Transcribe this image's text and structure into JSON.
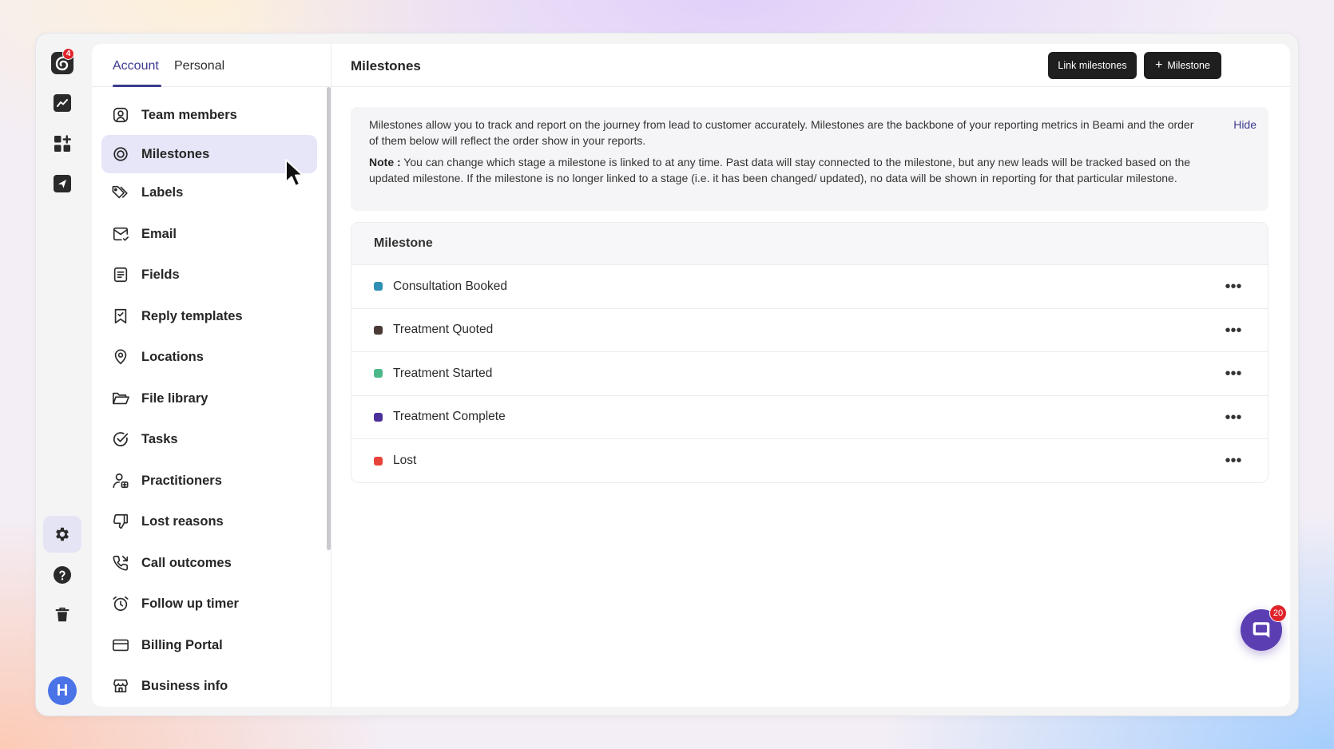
{
  "rail": {
    "logo_badge": "4",
    "avatar_initial": "H"
  },
  "settings_nav": {
    "tabs": [
      {
        "label": "Account",
        "active": true
      },
      {
        "label": "Personal",
        "active": false
      }
    ],
    "items": [
      {
        "label": "Team members",
        "icon": "user-square-icon"
      },
      {
        "label": "Milestones",
        "icon": "target-icon",
        "active": true
      },
      {
        "label": "Labels",
        "icon": "tags-icon"
      },
      {
        "label": "Email",
        "icon": "mail-check-icon"
      },
      {
        "label": "Fields",
        "icon": "form-fields-icon"
      },
      {
        "label": "Reply templates",
        "icon": "bookmark-check-icon"
      },
      {
        "label": "Locations",
        "icon": "map-pin-icon"
      },
      {
        "label": "File library",
        "icon": "folder-open-icon"
      },
      {
        "label": "Tasks",
        "icon": "check-circle-icon"
      },
      {
        "label": "Practitioners",
        "icon": "practitioner-icon"
      },
      {
        "label": "Lost reasons",
        "icon": "thumbs-down-icon"
      },
      {
        "label": "Call outcomes",
        "icon": "phone-outgoing-icon"
      },
      {
        "label": "Follow up timer",
        "icon": "alarm-clock-icon"
      },
      {
        "label": "Billing Portal",
        "icon": "credit-card-icon"
      },
      {
        "label": "Business info",
        "icon": "store-icon"
      }
    ]
  },
  "header": {
    "title": "Milestones",
    "link_button": "Link milestones",
    "add_button": "Milestone"
  },
  "info": {
    "text": "Milestones allow you to track and report on the journey from lead to customer accurately. Milestones are the backbone of your reporting metrics in Beami and the order of them below will reflect the order show in your reports.",
    "note_label": "Note :",
    "note_text": " You can change which stage a milestone is linked to at any time. Past data will stay connected to the milestone, but any new leads will be tracked based on the updated milestone. If the milestone is no longer linked to a stage (i.e. it has been changed/ updated), no data will be shown in reporting for that particular milestone.",
    "hide_label": "Hide"
  },
  "milestones": {
    "column_header": "Milestone",
    "rows": [
      {
        "name": "Consultation Booked",
        "color": "#2f8fb5"
      },
      {
        "name": "Treatment Quoted",
        "color": "#4a3a36"
      },
      {
        "name": "Treatment Started",
        "color": "#4cb88a"
      },
      {
        "name": "Treatment Complete",
        "color": "#4b2f9a"
      },
      {
        "name": "Lost",
        "color": "#e8433a"
      }
    ]
  },
  "chat": {
    "badge": "20"
  },
  "colors": {
    "accent": "#3b3b8f",
    "active_nav_bg": "#e6e6f8",
    "button_bg": "#1f1f1f",
    "chat": "#5b3fb2",
    "badge": "#e0242b"
  }
}
